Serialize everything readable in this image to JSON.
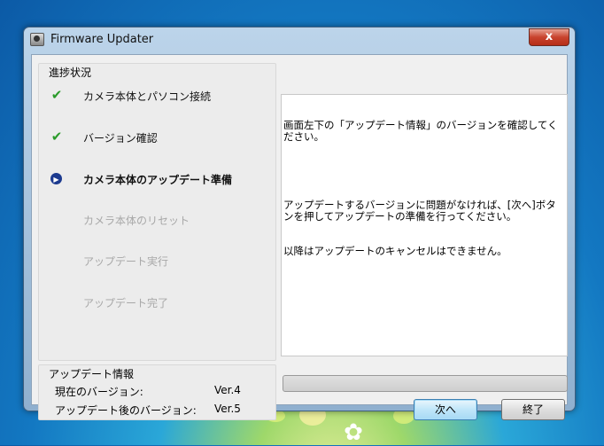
{
  "window": {
    "title": "Firmware Updater",
    "close_glyph": "x"
  },
  "progress": {
    "heading": "進捗状況",
    "steps": [
      {
        "label": "カメラ本体とパソコン接続",
        "state": "done"
      },
      {
        "label": "バージョン確認",
        "state": "done"
      },
      {
        "label": "カメラ本体のアップデート準備",
        "state": "current"
      },
      {
        "label": "カメラ本体のリセット",
        "state": "pending"
      },
      {
        "label": "アップデート実行",
        "state": "pending"
      },
      {
        "label": "アップデート完了",
        "state": "pending"
      }
    ]
  },
  "update_info": {
    "heading": "アップデート情報",
    "current_label": "現在のバージョン:",
    "current_value": "Ver.4",
    "after_label": "アップデート後のバージョン:",
    "after_value": "Ver.5"
  },
  "message": {
    "line1": "画面左下の「アップデート情報」のバージョンを確認してください。",
    "line2": "アップデートするバージョンに問題がなければ、[次へ]ボタンを押してアップデートの準備を行ってください。",
    "line3": "以降はアップデートのキャンセルはできません。"
  },
  "progress_bar": {
    "percent": 0
  },
  "buttons": {
    "next": "次へ",
    "exit": "終了"
  },
  "colors": {
    "check": "#2a9b2a",
    "current_marker": "#1c3a8f",
    "pending_text": "#a8a8a8"
  }
}
